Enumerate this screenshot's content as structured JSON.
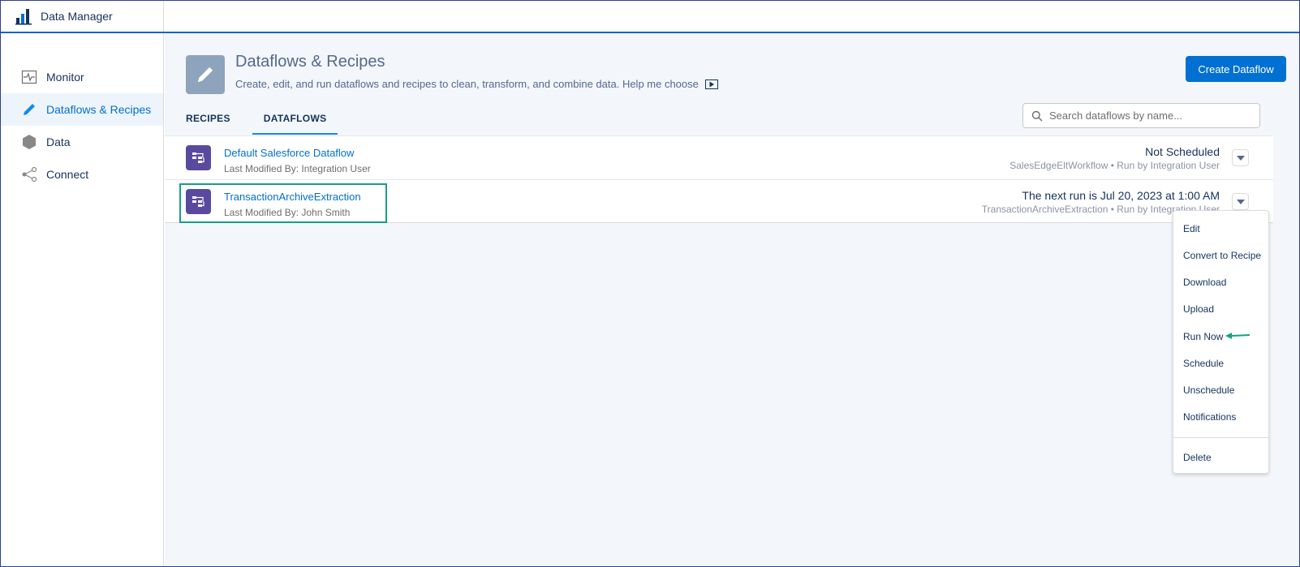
{
  "app": {
    "title": "Data Manager"
  },
  "sidebar": {
    "items": [
      {
        "label": "Monitor",
        "icon": "monitor-icon"
      },
      {
        "label": "Dataflows & Recipes",
        "icon": "pencil-icon",
        "active": true
      },
      {
        "label": "Data",
        "icon": "hexagon-icon"
      },
      {
        "label": "Connect",
        "icon": "share-icon"
      }
    ]
  },
  "header": {
    "title": "Dataflows & Recipes",
    "subtitle": "Create, edit, and run dataflows and recipes to clean, transform, and combine data. Help me choose",
    "create_label": "Create Dataflow"
  },
  "tabs": [
    {
      "label": "RECIPES",
      "active": false
    },
    {
      "label": "DATAFLOWS",
      "active": true
    }
  ],
  "search": {
    "placeholder": "Search dataflows by name..."
  },
  "rows": [
    {
      "name": "Default Salesforce Dataflow",
      "modified": "Last Modified By: Integration User",
      "status": "Not Scheduled",
      "workflow": "SalesEdgeEltWorkflow • Run by Integration User"
    },
    {
      "name": "TransactionArchiveExtraction",
      "modified": "Last Modified By: John Smith",
      "status": "The next run is Jul 20, 2023 at 1:00 AM",
      "workflow": "TransactionArchiveExtraction • Run by Integration User"
    }
  ],
  "menu": {
    "items": [
      "Edit",
      "Convert to Recipe",
      "Download",
      "Upload",
      "Run Now",
      "Schedule",
      "Unschedule",
      "Notifications"
    ],
    "delete_label": "Delete"
  },
  "colors": {
    "brand": "#0070d2",
    "highlight": "#14a085",
    "dataflow_icon": "#5a4a9f"
  }
}
